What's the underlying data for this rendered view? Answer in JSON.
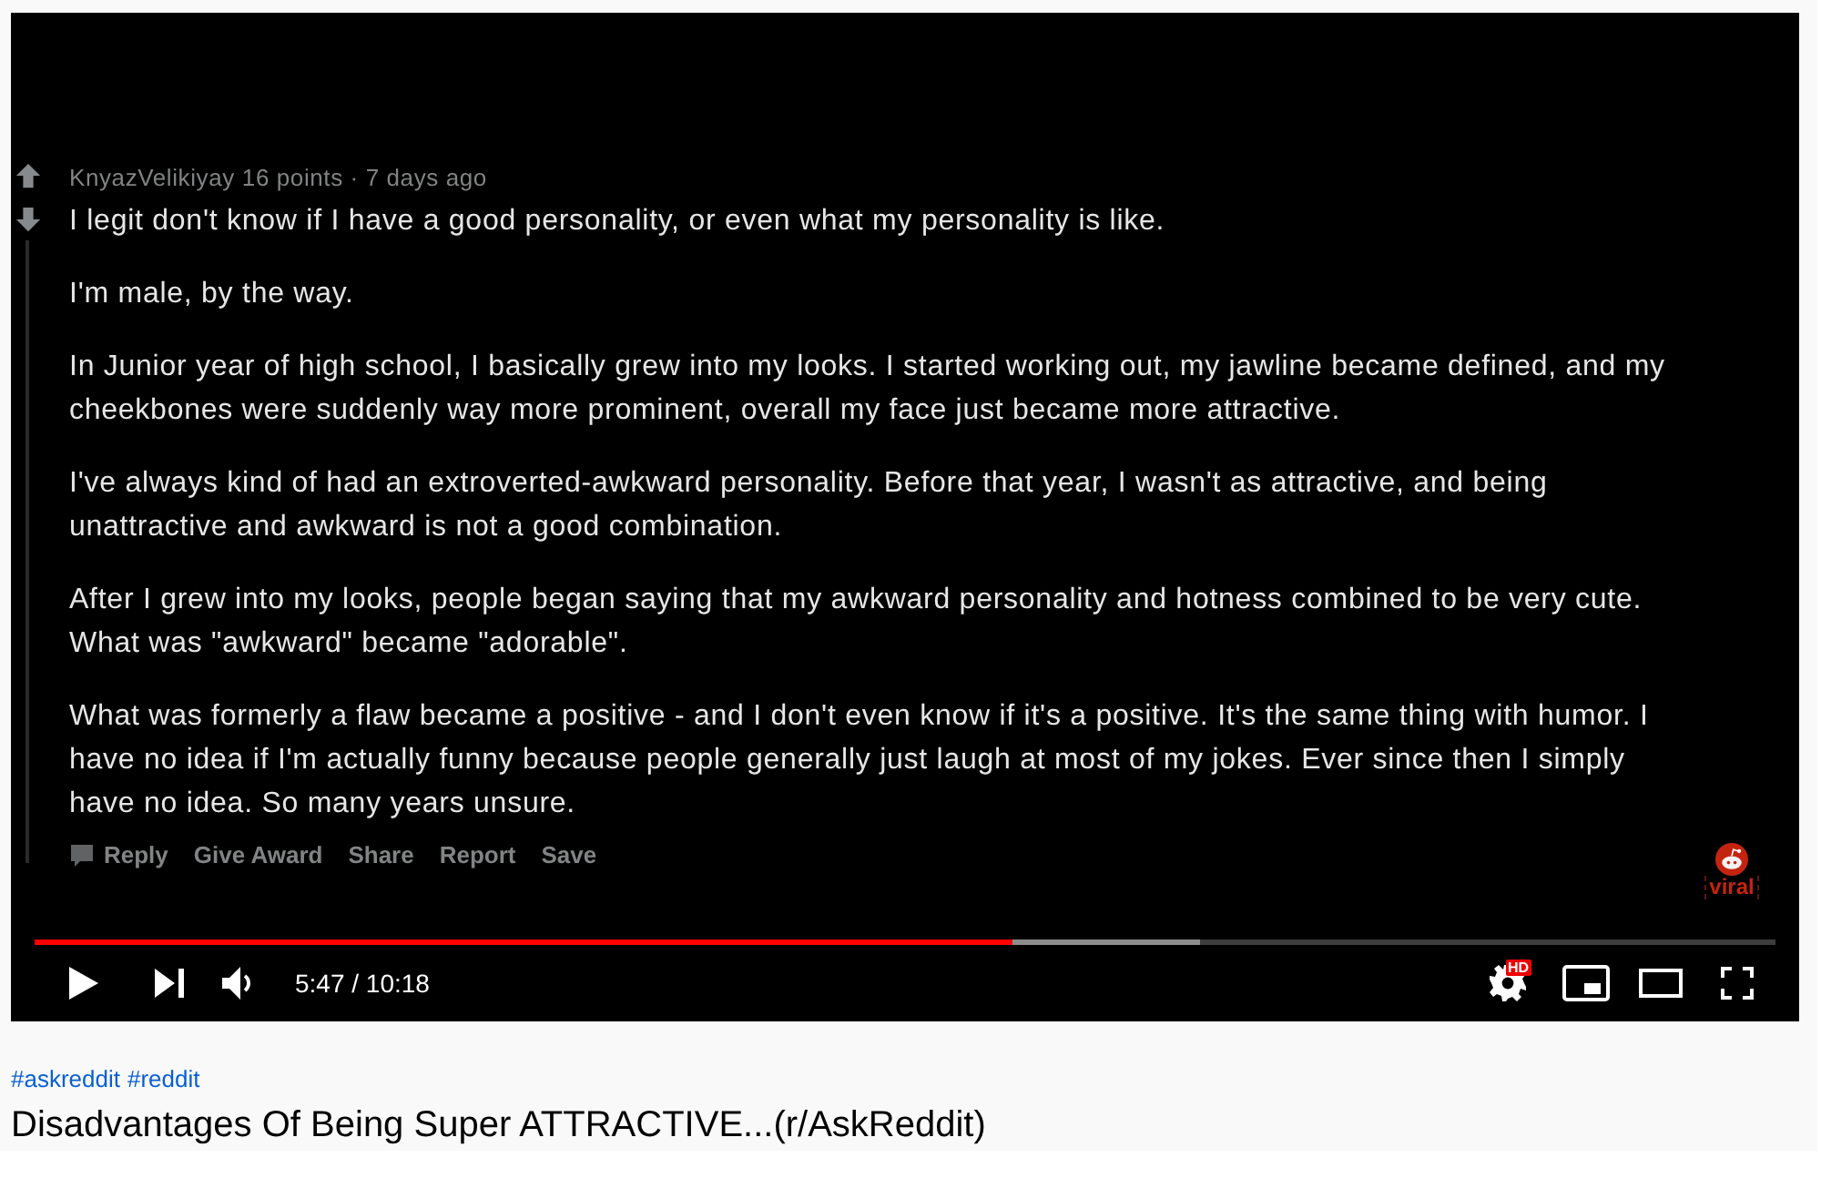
{
  "video": {
    "comment": {
      "author": "KnyazVelikiyay",
      "meta": "16 points · 7 days ago",
      "paragraphs": [
        "I legit don't know if I have a good personality, or even what my personality is like.",
        "I'm male, by the way.",
        "In Junior year of high school, I basically grew into my looks. I started working out, my jawline became defined, and my cheekbones were suddenly way more prominent, overall my face just became more attractive.",
        "I've always kind of had an extroverted-awkward personality. Before that year, I wasn't as attractive, and being unattractive and awkward is not a good combination.",
        "After I grew into my looks, people began saying that my awkward personality and hotness combined to be very cute. What was \"awkward\" became \"adorable\".",
        "What was formerly a flaw became a positive - and I don't even know if it's a positive. It's the same thing with humor. I have no idea if I'm actually funny because people generally just laugh at most of my jokes. Ever since then I simply have no idea. So many years unsure."
      ],
      "actions": [
        {
          "label": "Reply",
          "icon": true
        },
        {
          "label": "Give Award",
          "icon": false
        },
        {
          "label": "Share",
          "icon": false
        },
        {
          "label": "Report",
          "icon": false
        },
        {
          "label": "Save",
          "icon": false
        }
      ]
    },
    "channel_logo": {
      "text": "viral"
    }
  },
  "player": {
    "progress": {
      "level": 0.562
    },
    "buffered": {
      "level": 0.669
    },
    "time": "5:47 / 10:18",
    "hd_badge": "HD"
  },
  "hashtags": [
    "#askreddit",
    "#reddit"
  ],
  "title": "Disadvantages Of Being Super ATTRACTIVE...(r/AskReddit)"
}
